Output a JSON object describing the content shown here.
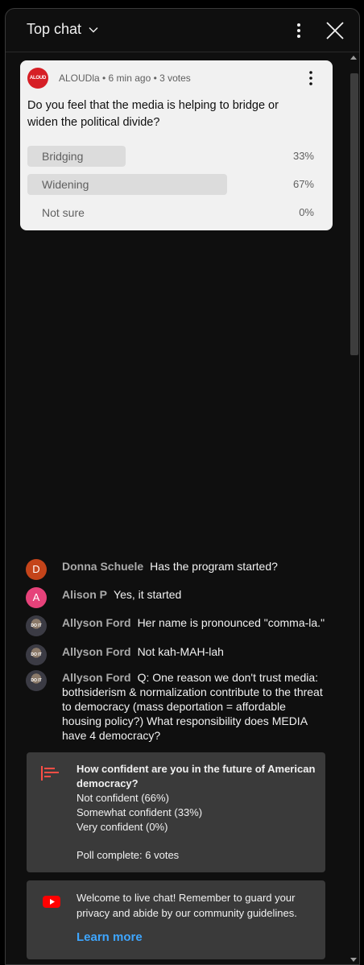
{
  "header": {
    "title": "Top chat"
  },
  "poll": {
    "avatar_text": "ALOUD",
    "meta": "ALOUDla • 6 min ago • 3 votes",
    "question": "Do you feel that the media is helping to bridge or widen the political divide?",
    "options": [
      {
        "label": "Bridging",
        "percent_text": "33%",
        "fraction": 0.33
      },
      {
        "label": "Widening",
        "percent_text": "67%",
        "fraction": 0.67
      },
      {
        "label": "Not sure",
        "percent_text": "0%",
        "fraction": 0.0
      }
    ],
    "accent": "#d61f26"
  },
  "messages": [
    {
      "avatar_letter": "D",
      "avatar_color": "#c4441a",
      "author": "Donna Schuele",
      "text": "Has the program started?"
    },
    {
      "avatar_letter": "A",
      "avatar_color": "#e6427a",
      "author": "Alison P",
      "text": "Yes, it started"
    },
    {
      "avatar_text": "DO IT",
      "author": "Allyson Ford",
      "text": "Her name is pronounced \"comma-la.\""
    },
    {
      "avatar_text": "DO IT",
      "author": "Allyson Ford",
      "text": "Not kah-MAH-lah"
    },
    {
      "avatar_text": "DO IT",
      "author": "Allyson Ford",
      "text": "Q: One reason we don't trust media: bothsiderism & normalization contribute to the threat to democracy (mass deportation = affordable housing policy?) What responsibility does MEDIA have 4 democracy?"
    }
  ],
  "poll_result": {
    "title": "How confident are you in the future of American democracy?",
    "lines": [
      "Not confident (66%)",
      "Somewhat confident (33%)",
      "Very confident (0%)"
    ],
    "complete": "Poll complete: 6 votes"
  },
  "welcome": {
    "text": "Welcome to live chat! Remember to guard your privacy and abide by our community guidelines.",
    "link": "Learn more",
    "link_color": "#3ea6ff"
  }
}
